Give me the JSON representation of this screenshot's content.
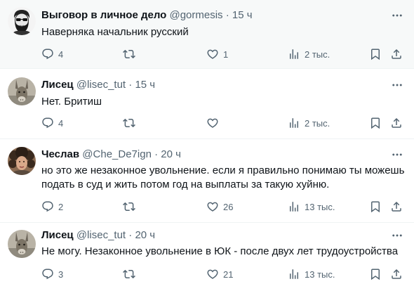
{
  "tweets": [
    {
      "name": "Выговор в личное дело",
      "handle": "@gormesis",
      "dot": "·",
      "time": "15 ч",
      "text": "Наверняка начальник русский",
      "replies": "4",
      "retweets": "",
      "likes": "1",
      "views": "2 тыс.",
      "avatar": "bearded-man-avatar"
    },
    {
      "name": "Лисец",
      "handle": "@lisec_tut",
      "dot": "·",
      "time": "15 ч",
      "text": "Нет. Бритиш",
      "replies": "4",
      "retweets": "",
      "likes": "",
      "views": "2 тыс.",
      "avatar": "donkey-avatar"
    },
    {
      "name": "Чеслав",
      "handle": "@Che_De7ign",
      "dot": "·",
      "time": "20 ч",
      "text": "но это же незаконное увольнение. если я правильно понимаю ты можешь подать в суд и жить потом год на выплаты за такую хуйню.",
      "replies": "2",
      "retweets": "",
      "likes": "26",
      "views": "13 тыс.",
      "avatar": "curly-hair-avatar"
    },
    {
      "name": "Лисец",
      "handle": "@lisec_tut",
      "dot": "·",
      "time": "20 ч",
      "text": "Не могу. Незаконное увольнение в ЮК - после двух лет трудоустройства",
      "replies": "3",
      "retweets": "",
      "likes": "21",
      "views": "13 тыс.",
      "avatar": "donkey-avatar"
    }
  ],
  "colors": {
    "text": "#0f1419",
    "secondary": "#536471",
    "divider": "#eff3f4",
    "highlight_bg": "#f7f9f9"
  }
}
